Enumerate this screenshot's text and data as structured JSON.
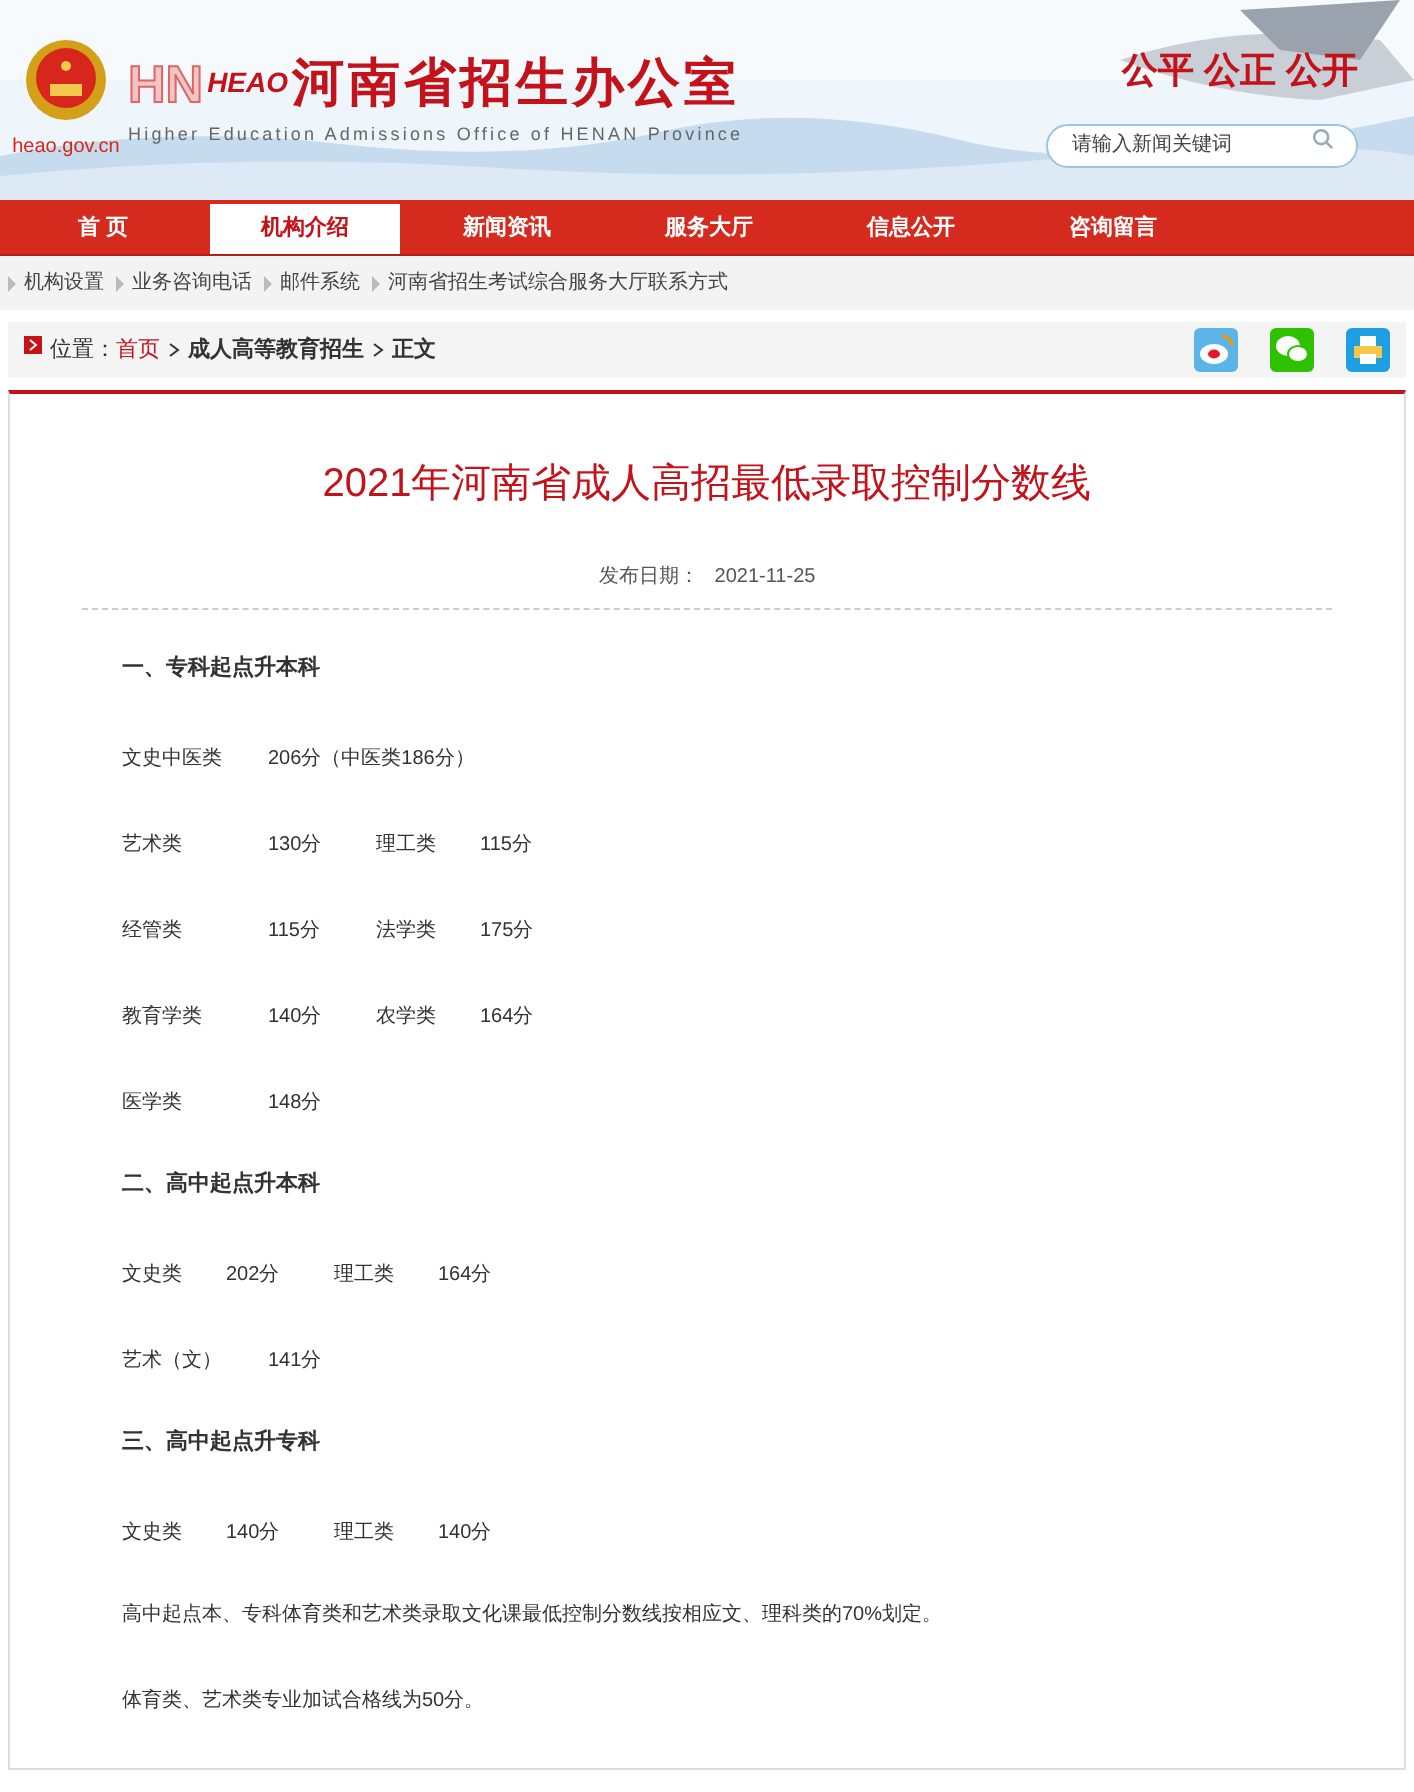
{
  "header": {
    "logo_mark": "HN",
    "logo_abbr": "HEAO",
    "site_name": "河南省招生办公室",
    "site_name_en": "Higher Education Admissions Office of HENAN Province",
    "domain": "heao.gov.cn",
    "slogan": "公平 公正 公开",
    "search": {
      "placeholder": "请输入新闻关键词"
    }
  },
  "nav": [
    {
      "label": "首 页",
      "selected": false
    },
    {
      "label": "机构介绍",
      "selected": true
    },
    {
      "label": "新闻资讯",
      "selected": false
    },
    {
      "label": "服务大厅",
      "selected": false
    },
    {
      "label": "信息公开",
      "selected": false
    },
    {
      "label": "咨询留言",
      "selected": false
    }
  ],
  "subnav": [
    "机构设置",
    "业务咨询电话",
    "邮件系统",
    "河南省招生考试综合服务大厅联系方式"
  ],
  "location": {
    "label": "位置：",
    "crumbs": [
      {
        "text": "首页",
        "kind": "link"
      },
      {
        "text": "成人高等教育招生",
        "kind": "current"
      },
      {
        "text": "正文",
        "kind": "current"
      }
    ]
  },
  "article": {
    "title": "2021年河南省成人高招最低录取控制分数线",
    "date_label": "发布日期：",
    "date": "2021-11-25",
    "blocks": [
      {
        "kind": "heading",
        "text": "一、专科起点升本科"
      },
      {
        "kind": "wide_scores",
        "cells": [
          "文史中医类",
          "206分（中医类186分）"
        ]
      },
      {
        "kind": "wide_scores",
        "cells": [
          "艺术类",
          "130分",
          "理工类",
          "115分"
        ]
      },
      {
        "kind": "wide_scores",
        "cells": [
          "经管类",
          "115分",
          "法学类",
          "175分"
        ]
      },
      {
        "kind": "wide_scores",
        "cells": [
          "教育学类",
          "140分",
          "农学类",
          "164分"
        ]
      },
      {
        "kind": "wide_scores",
        "cells": [
          "医学类",
          "148分"
        ]
      },
      {
        "kind": "heading",
        "text": "二、高中起点升本科"
      },
      {
        "kind": "scores",
        "cells": [
          "文史类",
          "202分",
          "理工类",
          "164分"
        ]
      },
      {
        "kind": "wide_scores",
        "cells": [
          "艺术（文）",
          "141分"
        ]
      },
      {
        "kind": "heading",
        "text": "三、高中起点升专科"
      },
      {
        "kind": "scores",
        "cells": [
          "文史类",
          "140分",
          "理工类",
          "140分"
        ]
      },
      {
        "kind": "paragraph",
        "text": "高中起点本、专科体育类和艺术类录取文化课最低控制分数线按相应文、理科类的70%划定。"
      },
      {
        "kind": "paragraph",
        "text": "体育类、艺术类专业加试合格线为50分。"
      }
    ]
  }
}
